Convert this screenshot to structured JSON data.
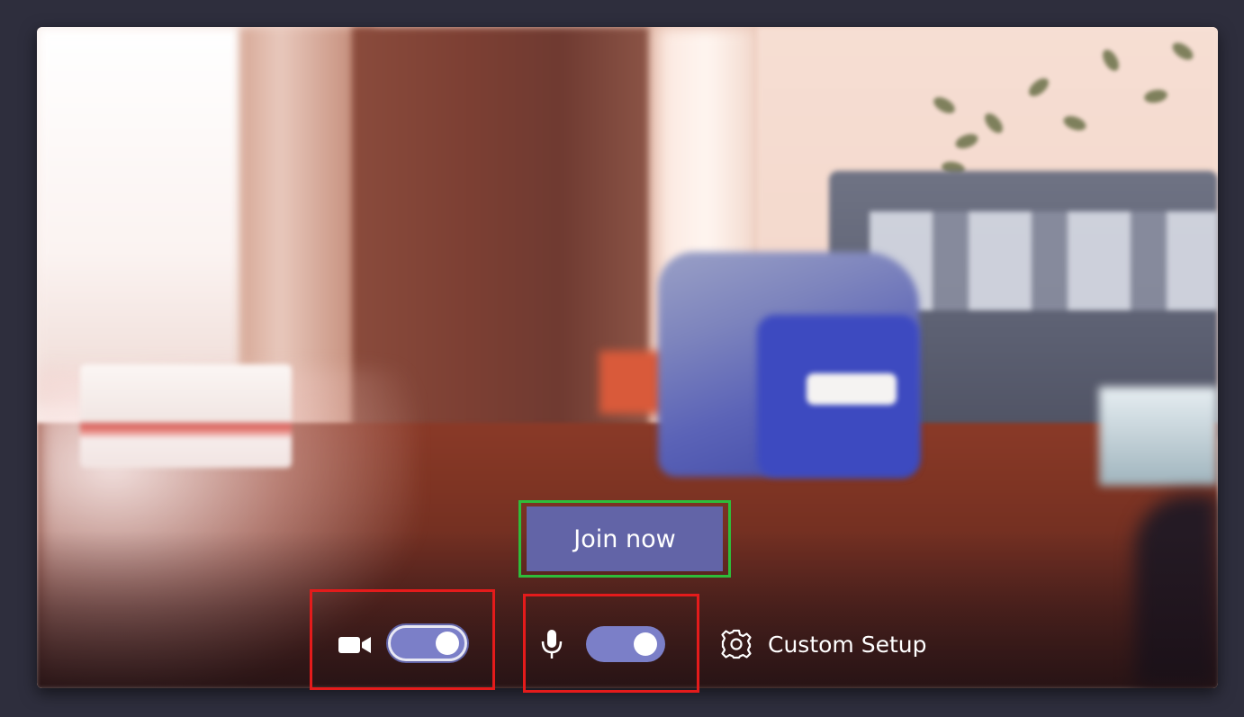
{
  "join_button": {
    "label": "Join now",
    "color": "#6264a7"
  },
  "camera": {
    "icon": "video-camera-icon",
    "toggle_state": "on"
  },
  "microphone": {
    "icon": "microphone-icon",
    "toggle_state": "on"
  },
  "setup": {
    "icon": "gear-icon",
    "label": "Custom Setup"
  },
  "highlights": {
    "join_box_color": "#2ebd3a",
    "toggle_box_color": "#e41b1b"
  },
  "colors": {
    "toggle_on": "#7b7fc8",
    "background": "#2e2e3d"
  }
}
